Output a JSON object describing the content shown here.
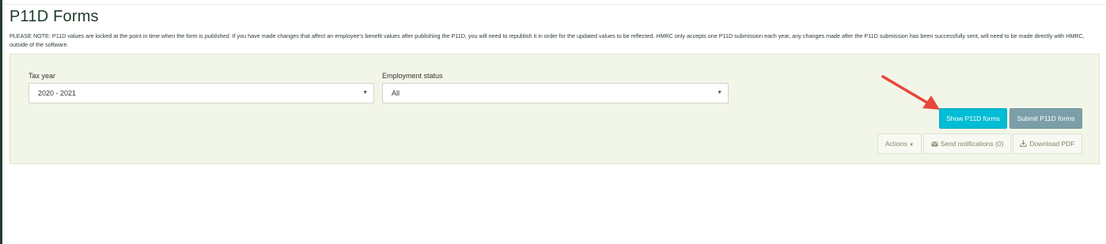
{
  "page": {
    "title": "P11D Forms",
    "notice_part1": "PLEASE NOTE: P11D values are locked at the point in time when the form is ",
    "notice_emphasis": "published",
    "notice_part2": ". If you have made changes that affect an employee's benefit values after publishing the P11D, you will need to republish it in order for the updated values to be reflected. HMRC only accepts one P11D submission each year, any changes made after the P11D submission has been successfully sent, will need to be made directly with HMRC, outside of the software."
  },
  "filters": {
    "tax_year_label": "Tax year",
    "tax_year_value": "2020 - 2021",
    "employment_status_label": "Employment status",
    "employment_status_value": "All"
  },
  "buttons": {
    "show": "Show P11D forms",
    "submit": "Submit P11D forms",
    "actions": "Actions",
    "send_notifications": "Send notifications (0)",
    "download_pdf": "Download PDF"
  },
  "colors": {
    "show_button": "#00bcd4",
    "submit_button": "#7b9fa8",
    "panel": "#f2f6e8",
    "annotation_arrow": "#e8473a"
  },
  "icons": {
    "caret": "caret-down-icon",
    "envelope": "envelope-icon",
    "download": "download-icon"
  }
}
